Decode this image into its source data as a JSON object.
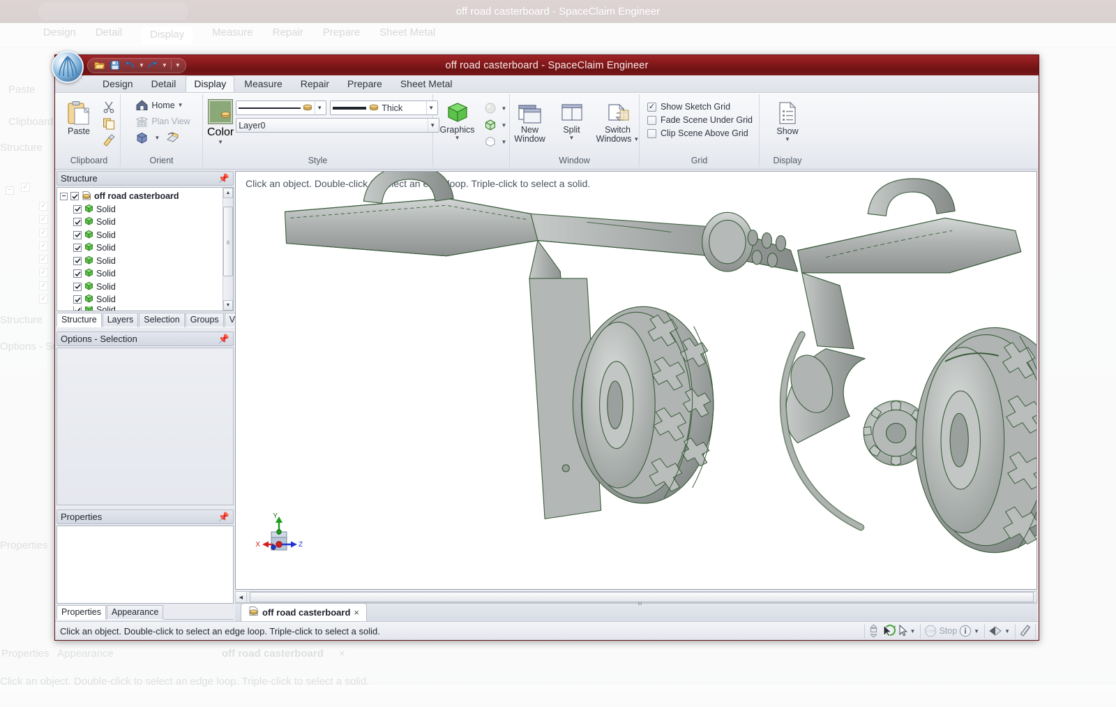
{
  "window": {
    "title": "off road casterboard - SpaceClaim Engineer",
    "orb_icon": "spaceclaim-logo-icon"
  },
  "quick_access": {
    "items": [
      {
        "name": "open-icon",
        "glyph": "folder"
      },
      {
        "name": "save-icon",
        "glyph": "floppy"
      },
      {
        "name": "undo-icon",
        "glyph": "undo"
      },
      {
        "name": "redo-icon",
        "glyph": "redo"
      },
      {
        "name": "customize-qat-icon",
        "glyph": "caret"
      }
    ]
  },
  "ribbon": {
    "tabs": [
      {
        "label": "Design",
        "active": false
      },
      {
        "label": "Detail",
        "active": false
      },
      {
        "label": "Display",
        "active": true
      },
      {
        "label": "Measure",
        "active": false
      },
      {
        "label": "Repair",
        "active": false
      },
      {
        "label": "Prepare",
        "active": false
      },
      {
        "label": "Sheet Metal",
        "active": false
      }
    ],
    "groups": {
      "clipboard": {
        "label": "Clipboard",
        "paste_label": "Paste",
        "cut_label": "Cut",
        "copy_label": "Copy",
        "format_painter_label": "Format Painter"
      },
      "orient": {
        "label": "Orient",
        "home_label": "Home",
        "plan_view_label": "Plan View",
        "view_label": "View",
        "spin_label": "Spin"
      },
      "style": {
        "label": "Style",
        "color_label": "Color",
        "line_style_value": "",
        "line_weight_value": "Thick",
        "layer_value": "Layer0"
      },
      "graphics": {
        "label": "",
        "graphics_label": "Graphics",
        "shaded_label": "Shaded",
        "wireframe_label": "Wireframe",
        "hidden_line_label": "Hidden Line"
      },
      "window": {
        "label": "Window",
        "new_window_label": "New\nWindow",
        "new_window_line1": "New",
        "new_window_line2": "Window",
        "split_label": "Split",
        "switch_windows_line1": "Switch",
        "switch_windows_line2": "Windows"
      },
      "grid": {
        "label": "Grid",
        "checks": [
          {
            "label": "Show Sketch Grid",
            "checked": true
          },
          {
            "label": "Fade Scene Under Grid",
            "checked": false
          },
          {
            "label": "Clip Scene Above Grid",
            "checked": false
          }
        ]
      },
      "display": {
        "label": "Display",
        "show_label": "Show"
      }
    }
  },
  "structure_panel": {
    "title": "Structure",
    "pin_icon": "pin-icon",
    "root": {
      "label": "off road casterboard",
      "checked": true,
      "expanded": true
    },
    "children": [
      {
        "label": "Solid",
        "checked": true
      },
      {
        "label": "Solid",
        "checked": true
      },
      {
        "label": "Solid",
        "checked": true
      },
      {
        "label": "Solid",
        "checked": true
      },
      {
        "label": "Solid",
        "checked": true
      },
      {
        "label": "Solid",
        "checked": true
      },
      {
        "label": "Solid",
        "checked": true
      },
      {
        "label": "Solid",
        "checked": true
      },
      {
        "label": "Solid",
        "checked": true
      }
    ],
    "tabs": [
      {
        "label": "Structure",
        "active": true
      },
      {
        "label": "Layers",
        "active": false
      },
      {
        "label": "Selection",
        "active": false
      },
      {
        "label": "Groups",
        "active": false
      },
      {
        "label": "Views",
        "active": false
      }
    ]
  },
  "options_panel": {
    "title": "Options - Selection",
    "pin_icon": "pin-icon"
  },
  "properties_panel": {
    "title": "Properties",
    "pin_icon": "pin-icon",
    "tabs": [
      {
        "label": "Properties",
        "active": true
      },
      {
        "label": "Appearance",
        "active": false
      }
    ]
  },
  "viewport": {
    "hint": "Click an object. Double-click to select an edge loop. Triple-click to select a solid.",
    "model_name": "off road casterboard",
    "triad": {
      "x_label": "X",
      "y_label": "Y",
      "z_label": "Z",
      "x_color": "#d22020",
      "y_color": "#1b9e1b",
      "z_color": "#1f35d0"
    },
    "shaded_color": "#a9aeae",
    "edge_color": "#3c5c3c"
  },
  "document_tabs": [
    {
      "label": "off road casterboard",
      "active": true,
      "close": "×"
    }
  ],
  "status_bar": {
    "message": "Click an object. Double-click to select an edge loop. Triple-click to select a solid.",
    "stop_label": "Stop",
    "items": [
      {
        "name": "select-mode-icon"
      },
      {
        "name": "cursor-arrow-icon"
      },
      {
        "name": "stop-icon"
      },
      {
        "name": "info-icon"
      },
      {
        "name": "snap-icon"
      },
      {
        "name": "measure-icon"
      }
    ]
  },
  "colors": {
    "titlebar": "#86191b",
    "accent_green": "#8aa878",
    "ribbon_bg": "#eff1f5",
    "panel_bg": "#e8eaef"
  }
}
